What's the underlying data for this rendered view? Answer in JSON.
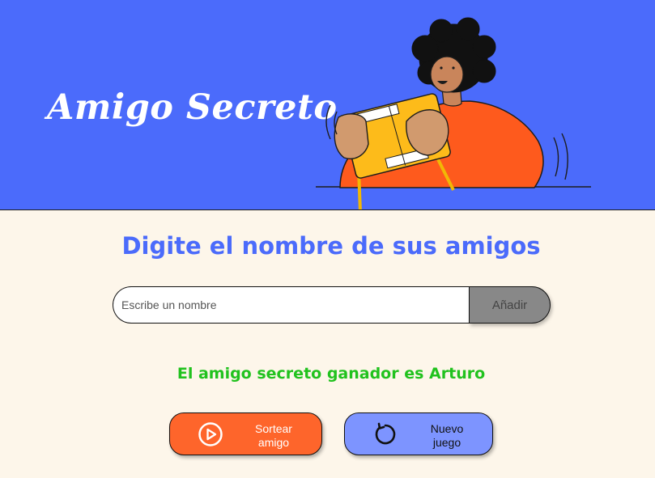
{
  "header": {
    "title": "Amigo Secreto",
    "background_color": "#4b6bfb",
    "illustration": "person-holding-gift-box"
  },
  "main": {
    "heading": "Digite el nombre de sus amigos",
    "name_input": {
      "placeholder": "Escribe un nombre",
      "value": ""
    },
    "add_button_label": "Añadir",
    "result_text": "El amigo secreto ganador es Arturo",
    "result_color": "#21c21e"
  },
  "actions": {
    "draw_button": {
      "label_line1": "Sortear",
      "label_line2": "amigo",
      "icon": "play-circle-icon",
      "color": "#fe652b"
    },
    "new_game_button": {
      "label_line1": "Nuevo",
      "label_line2": "juego",
      "icon": "refresh-icon",
      "color": "#7d94ff"
    }
  }
}
